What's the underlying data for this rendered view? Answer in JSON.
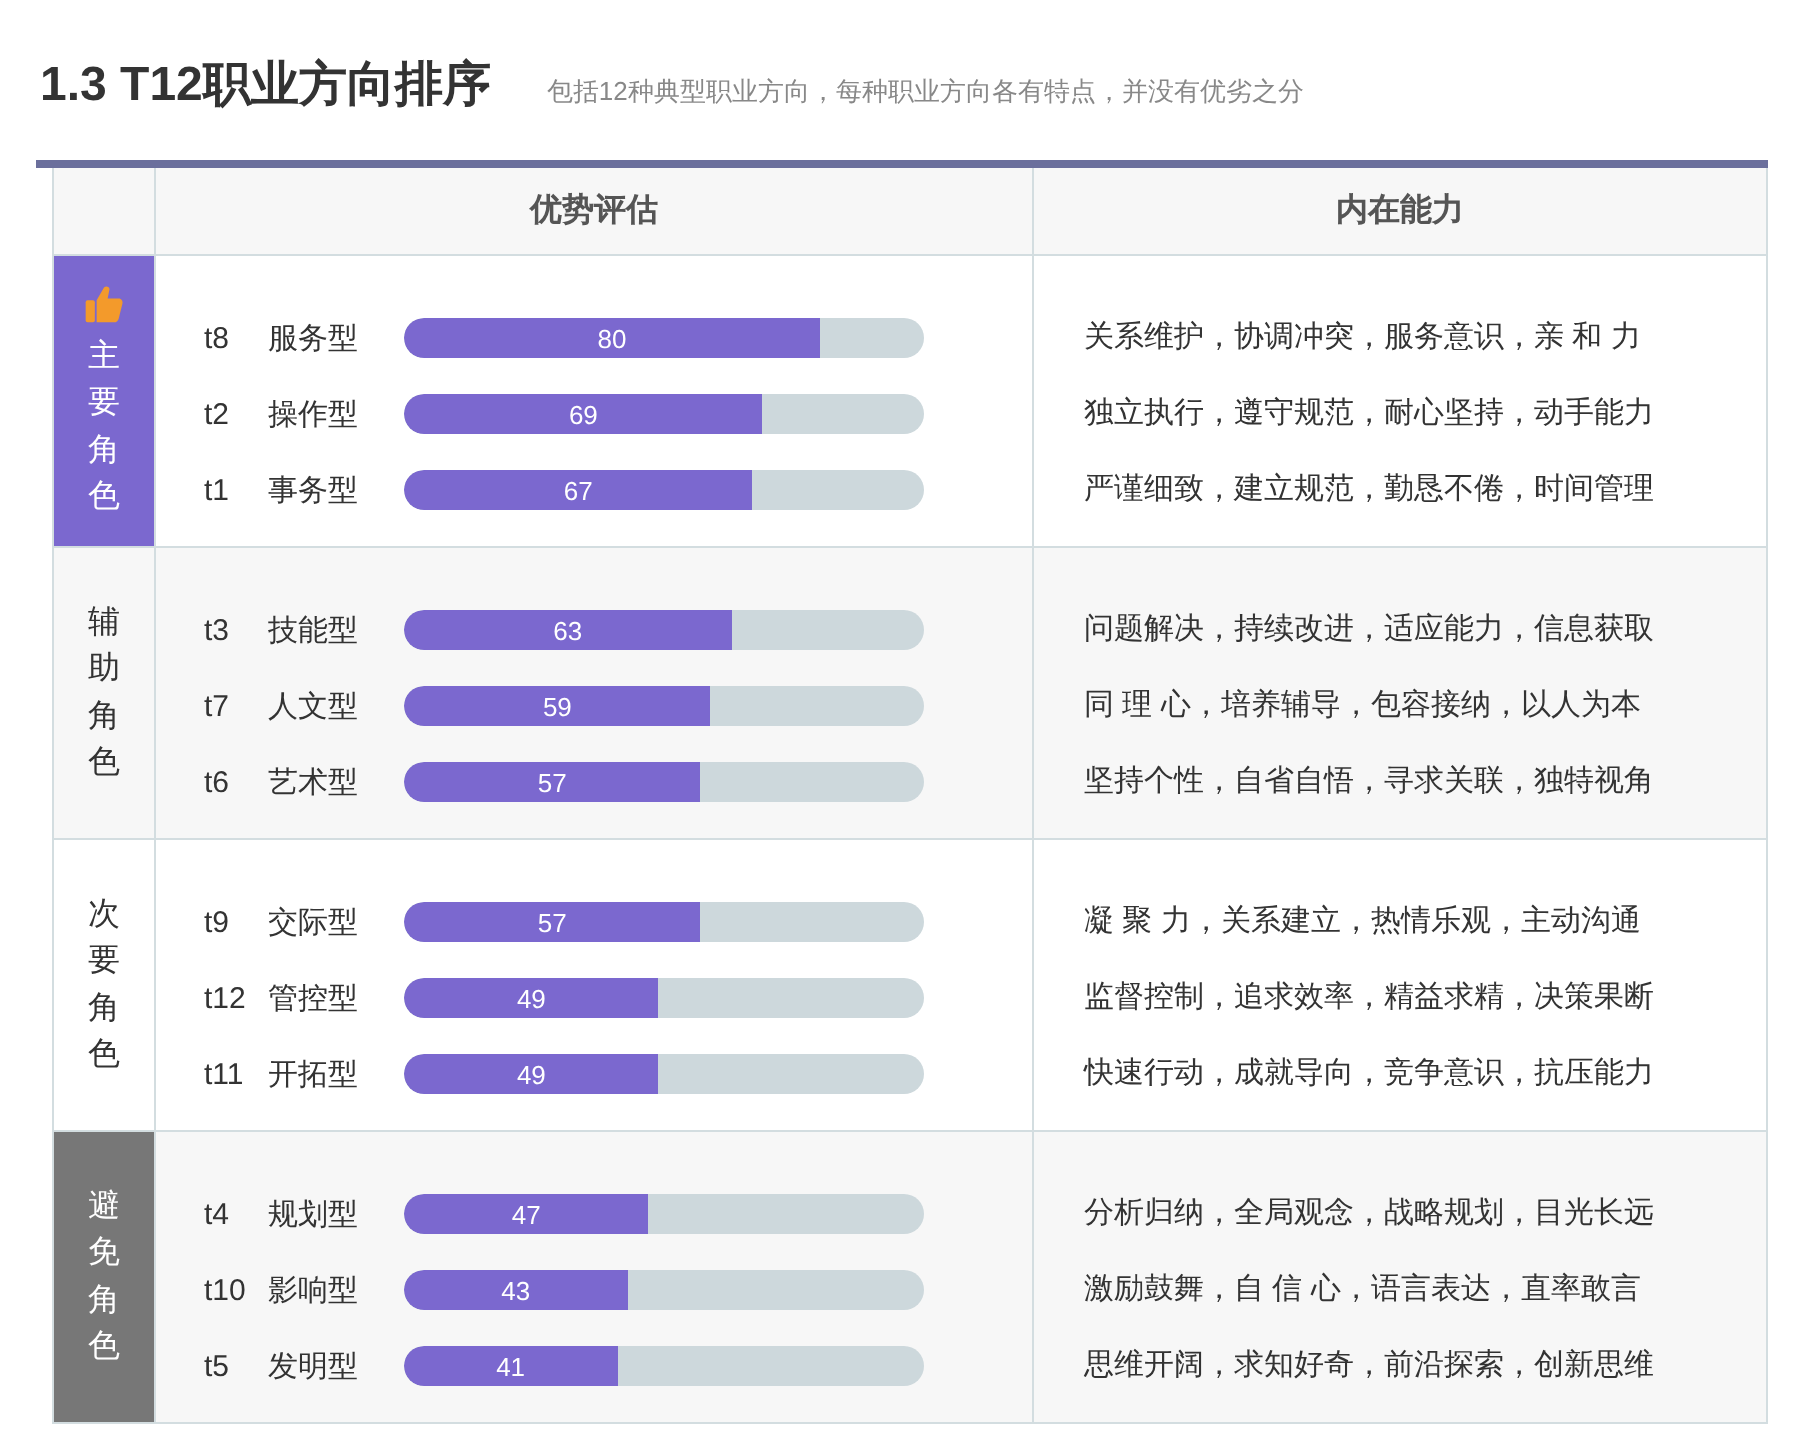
{
  "header": {
    "title": "1.3 T12职业方向排序",
    "subtitle": "包括12种典型职业方向，每种职业方向各有特点，并没有优劣之分"
  },
  "table": {
    "columns": [
      "优势评估",
      "内在能力"
    ],
    "groups": [
      {
        "label": "主要角色",
        "kind": "primary",
        "rows": [
          {
            "code": "t8",
            "name": "服务型",
            "level": 0.8,
            "reading": "80",
            "ability": "关系维护，协调冲突，服务意识，亲 和 力"
          },
          {
            "code": "t2",
            "name": "操作型",
            "level": 0.69,
            "reading": "69",
            "ability": "独立执行，遵守规范，耐心坚持，动手能力"
          },
          {
            "code": "t1",
            "name": "事务型",
            "level": 0.67,
            "reading": "67",
            "ability": "严谨细致，建立规范，勤恳不倦，时间管理"
          }
        ]
      },
      {
        "label": "辅助角色",
        "kind": "normal",
        "rows": [
          {
            "code": "t3",
            "name": "技能型",
            "level": 0.63,
            "reading": "63",
            "ability": "问题解决，持续改进，适应能力，信息获取"
          },
          {
            "code": "t7",
            "name": "人文型",
            "level": 0.59,
            "reading": "59",
            "ability": "同 理 心，培养辅导，包容接纳，以人为本"
          },
          {
            "code": "t6",
            "name": "艺术型",
            "level": 0.57,
            "reading": "57",
            "ability": "坚持个性，自省自悟，寻求关联，独特视角"
          }
        ]
      },
      {
        "label": "次要角色",
        "kind": "normal",
        "rows": [
          {
            "code": "t9",
            "name": "交际型",
            "level": 0.57,
            "reading": "57",
            "ability": "凝 聚 力，关系建立，热情乐观，主动沟通"
          },
          {
            "code": "t12",
            "name": "管控型",
            "level": 0.49,
            "reading": "49",
            "ability": "监督控制，追求效率，精益求精，决策果断"
          },
          {
            "code": "t11",
            "name": "开拓型",
            "level": 0.49,
            "reading": "49",
            "ability": "快速行动，成就导向，竞争意识，抗压能力"
          }
        ]
      },
      {
        "label": "避免角色",
        "kind": "avoid",
        "rows": [
          {
            "code": "t4",
            "name": "规划型",
            "level": 0.47,
            "reading": "47",
            "ability": "分析归纳，全局观念，战略规划，目光长远"
          },
          {
            "code": "t10",
            "name": "影响型",
            "level": 0.43,
            "reading": "43",
            "ability": "激励鼓舞，自 信 心，语言表达，直率敢言"
          },
          {
            "code": "t5",
            "name": "发明型",
            "level": 0.41,
            "reading": "41",
            "ability": "思维开阔，求知好奇，前沿探索，创新思维"
          }
        ]
      }
    ]
  }
}
